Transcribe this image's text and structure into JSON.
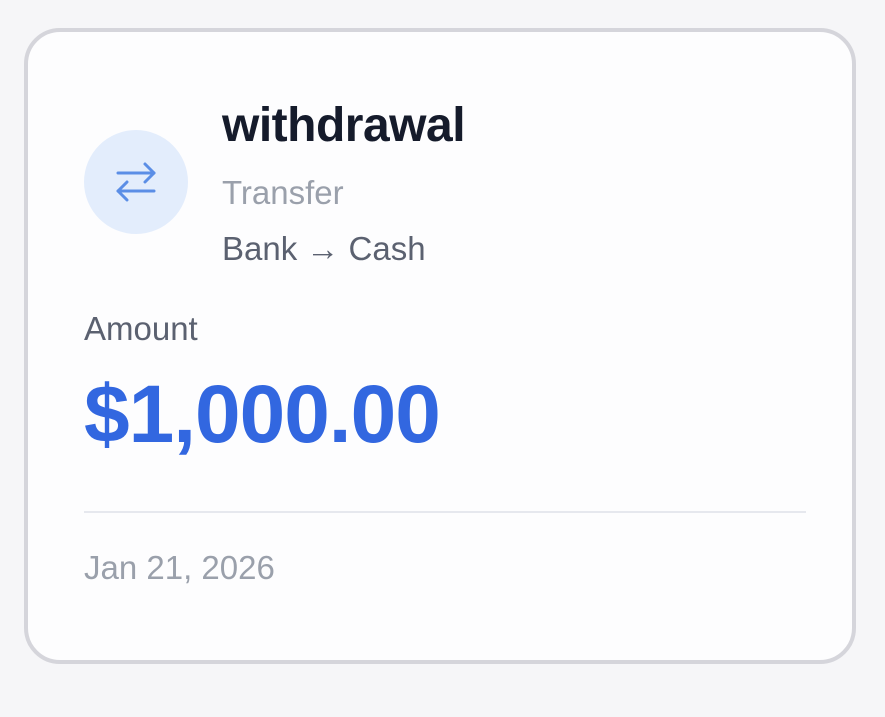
{
  "transaction": {
    "title": "withdrawal",
    "category": "Transfer",
    "route": "Bank → Cash",
    "amount_label": "Amount",
    "amount": "$1,000.00",
    "date": "Jan 21, 2026",
    "icon": "transfer-arrows-icon"
  },
  "colors": {
    "accent": "#3267e0",
    "icon_bg": "#e3edfc",
    "icon_fg": "#5b8ee6",
    "title": "#151b2b",
    "muted": "#9aa0ab",
    "secondary": "#5b6170",
    "border": "#d5d5db"
  }
}
